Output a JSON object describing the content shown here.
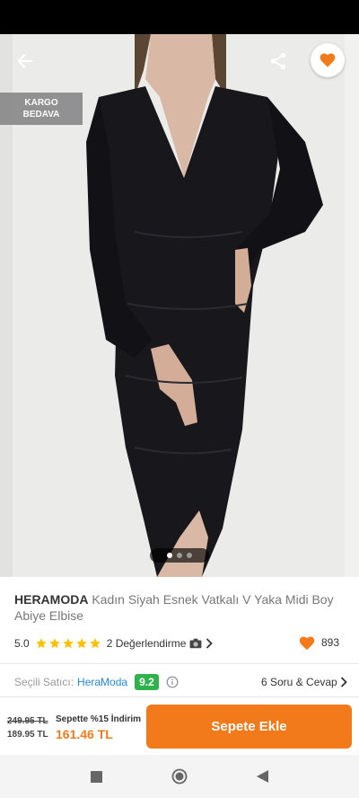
{
  "header": {
    "back_icon": "arrow-left-icon",
    "share_icon": "share-icon",
    "favorite_icon": "heart-icon"
  },
  "badge": {
    "line1": "KARGO",
    "line2": "BEDAVA"
  },
  "gallery": {
    "image_count": 3,
    "active_index": 0
  },
  "product": {
    "brand": "HERAMODA",
    "name": "Kadın Siyah Esnek Vatkalı V Yaka Midi Boy Abiye Elbise",
    "rating": "5.0",
    "stars": 5,
    "reviews_text": "2 Değerlendirme",
    "favorites": "893"
  },
  "seller": {
    "label": "Seçili Satıcı:",
    "name": "HeraModa",
    "score": "9.2",
    "qa_text": "6 Soru & Cevap"
  },
  "pricing": {
    "old_price": "249.95 TL",
    "current_price": "189.95 TL",
    "promo_label": "Sepette %15 İndirim",
    "promo_price": "161.46 TL"
  },
  "actions": {
    "add_to_cart": "Sepete Ekle"
  },
  "colors": {
    "accent": "#f27a1a",
    "seller_score": "#2fb24c",
    "link": "#1e88e5"
  }
}
